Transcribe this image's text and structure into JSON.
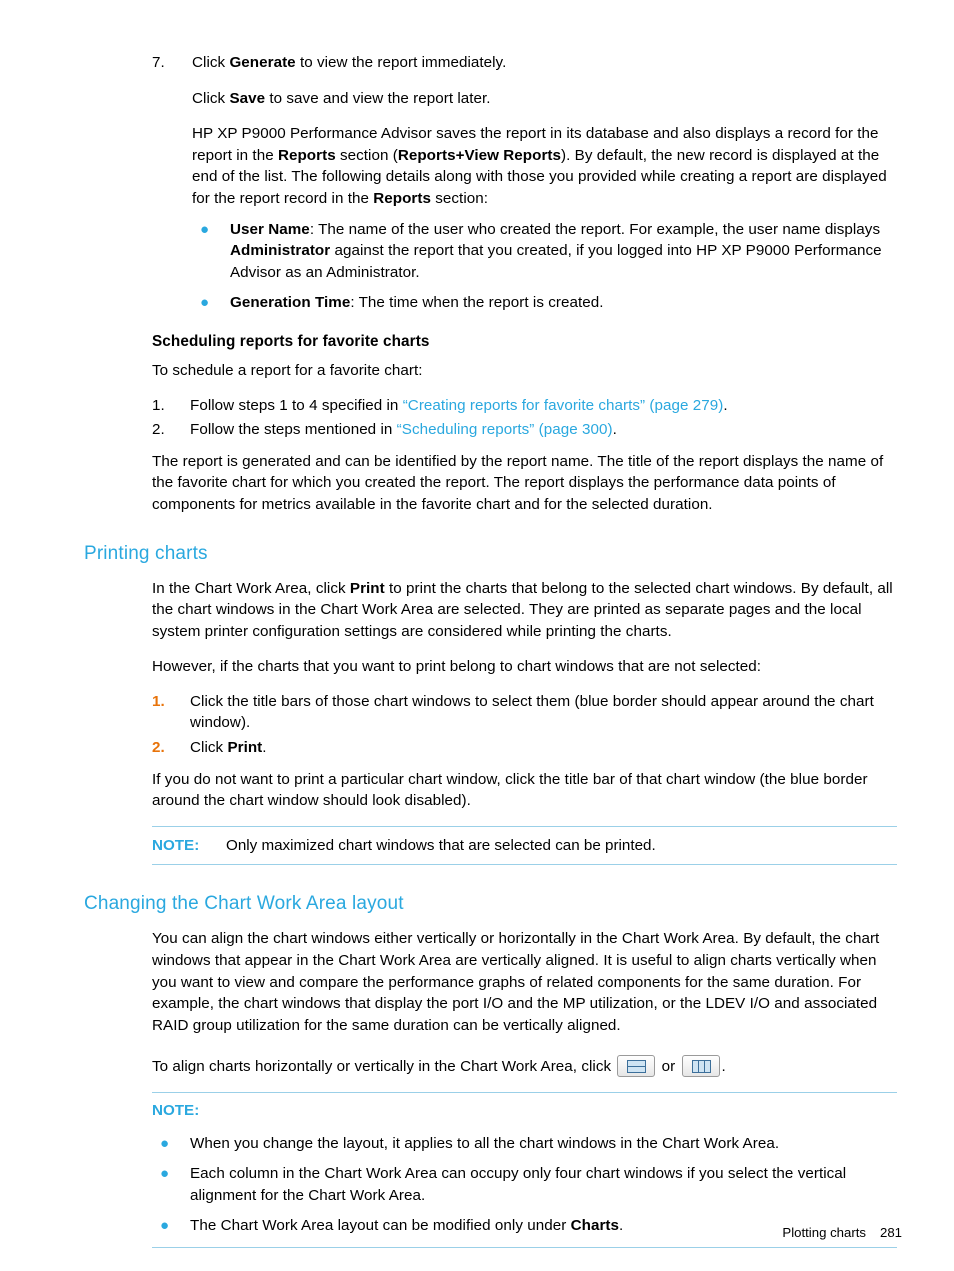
{
  "step7": {
    "number": "7.",
    "line1_pre": "Click ",
    "line1_bold": "Generate",
    "line1_post": " to view the report immediately.",
    "line2_pre": "Click ",
    "line2_bold": "Save",
    "line2_post": " to save and view the report later.",
    "para_a": "HP XP P9000 Performance Advisor saves the report in its database and also displays a record for the report in the ",
    "para_a_bold1": "Reports",
    "para_a_mid1": " section (",
    "para_a_bold2": "Reports",
    "para_a_plus": "+",
    "para_a_bold3": "View Reports",
    "para_a_mid2": "). By default, the new record is displayed at the end of the list. The following details along with those you provided while creating a report are displayed for the report record in the ",
    "para_a_bold4": "Reports",
    "para_a_end": " section:",
    "bullets": [
      {
        "bold_lead": "User Name",
        "text_1": ": The name of the user who created the report. For example, the user name displays ",
        "bold_mid": "Administrator",
        "text_2": " against the report that you created, if you logged into HP XP P9000 Performance Advisor as an Administrator."
      },
      {
        "bold_lead": "Generation Time",
        "text_1": ": The time when the report is created.",
        "bold_mid": "",
        "text_2": ""
      }
    ]
  },
  "scheduling": {
    "heading": "Scheduling reports for favorite charts",
    "intro": "To schedule a report for a favorite chart:",
    "steps": [
      {
        "num": "1.",
        "pre": "Follow steps 1 to 4 specified in ",
        "link": "“Creating reports for favorite charts” (page 279)",
        "post": "."
      },
      {
        "num": "2.",
        "pre": "Follow the steps mentioned in ",
        "link": "“Scheduling reports” (page 300)",
        "post": "."
      }
    ],
    "closing": "The report is generated and can be identified by the report name. The title of the report displays the name of the favorite chart for which you created the report. The report displays the performance data points of components for metrics available in the favorite chart and for the selected duration."
  },
  "printing": {
    "heading": "Printing charts",
    "para1_pre": "In the Chart Work Area, click ",
    "para1_bold": "Print",
    "para1_post": " to print the charts that belong to the selected chart windows. By default, all the chart windows in the Chart Work Area are selected. They are printed as separate pages and the local system printer configuration settings are considered while printing the charts.",
    "para2": "However, if the charts that you want to print belong to chart windows that are not selected:",
    "steps": [
      {
        "num": "1.",
        "text": "Click the title bars of those chart windows to select them (blue border should appear around the chart window)."
      },
      {
        "num": "2.",
        "text_pre": "Click ",
        "text_bold": "Print",
        "text_post": "."
      }
    ],
    "para3": "If you do not want to print a particular chart window, click the title bar of that chart window (the blue border around the chart window should look disabled).",
    "note_label": "NOTE:",
    "note_text": "Only maximized chart windows that are selected can be printed."
  },
  "layout": {
    "heading": "Changing the Chart Work Area layout",
    "para1": "You can align the chart windows either vertically or horizontally in the Chart Work Area. By default, the chart windows that appear in the Chart Work Area are vertically aligned. It is useful to align charts vertically when you want to view and compare the performance graphs of related components for the same duration. For example, the chart windows that display the port I/O and the MP utilization, or the LDEV I/O and associated RAID group utilization for the same duration can be vertically aligned.",
    "para2_pre": "To align charts horizontally or vertically in the Chart Work Area, click ",
    "para2_or": " or ",
    "para2_post": ".",
    "icon_horizontal": "horizontal-layout-icon",
    "icon_vertical": "vertical-layout-icon",
    "note_label": "NOTE:",
    "note_bullets": [
      "When you change the layout, it applies to all the chart windows in the Chart Work Area.",
      "Each column in the Chart Work Area can occupy only four chart windows if you select the vertical alignment for the Chart Work Area.",
      "The Chart Work Area layout can be modified only under "
    ],
    "note_bullet3_bold": "Charts",
    "note_bullet3_post": "."
  },
  "footer": {
    "label": "Plotting charts",
    "page": "281"
  },
  "colors": {
    "link": "#2aa8df",
    "heading": "#2aa8df",
    "orange": "#e8730a",
    "rule": "#9bd0e8"
  }
}
